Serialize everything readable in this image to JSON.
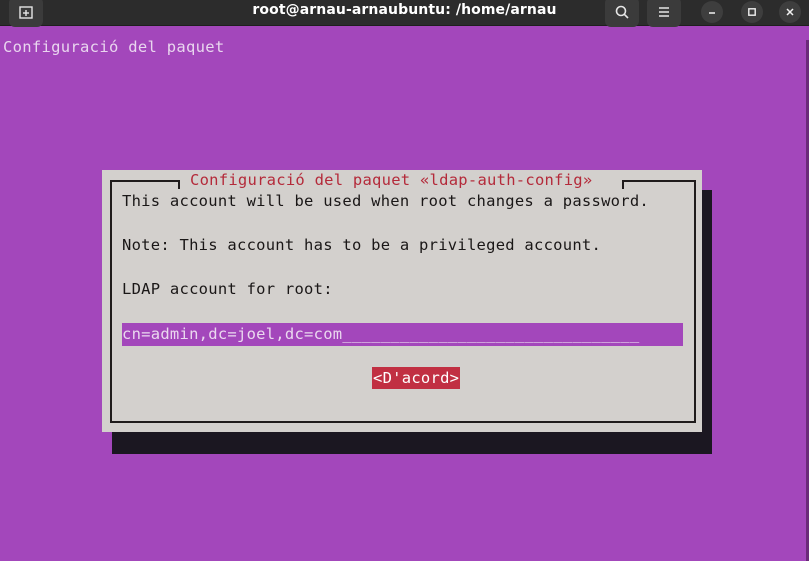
{
  "window": {
    "title": "root@arnau-arnaubuntu: /home/arnau"
  },
  "terminal": {
    "header": "Configuració del paquet"
  },
  "dialog": {
    "title": "Configuració del paquet «ldap-auth-config»",
    "line1": "This account will be used when root changes a password.",
    "line2": "Note: This account has to be a privileged account.",
    "line3": "LDAP account for root:",
    "input_value": "cn=admin,dc=joel,dc=com",
    "input_fill": "_______________________________",
    "ok_label": "<D'acord>"
  },
  "icons": {
    "new_tab": "new-tab-icon",
    "search": "search-icon",
    "menu": "hamburger-menu-icon",
    "minimize": "minimize-icon",
    "maximize": "maximize-icon",
    "close": "close-icon"
  },
  "colors": {
    "terminal_bg": "#a347bb",
    "dialog_bg": "#d3d0cd",
    "title_red": "#b42a3a",
    "button_red": "#c12f42"
  }
}
